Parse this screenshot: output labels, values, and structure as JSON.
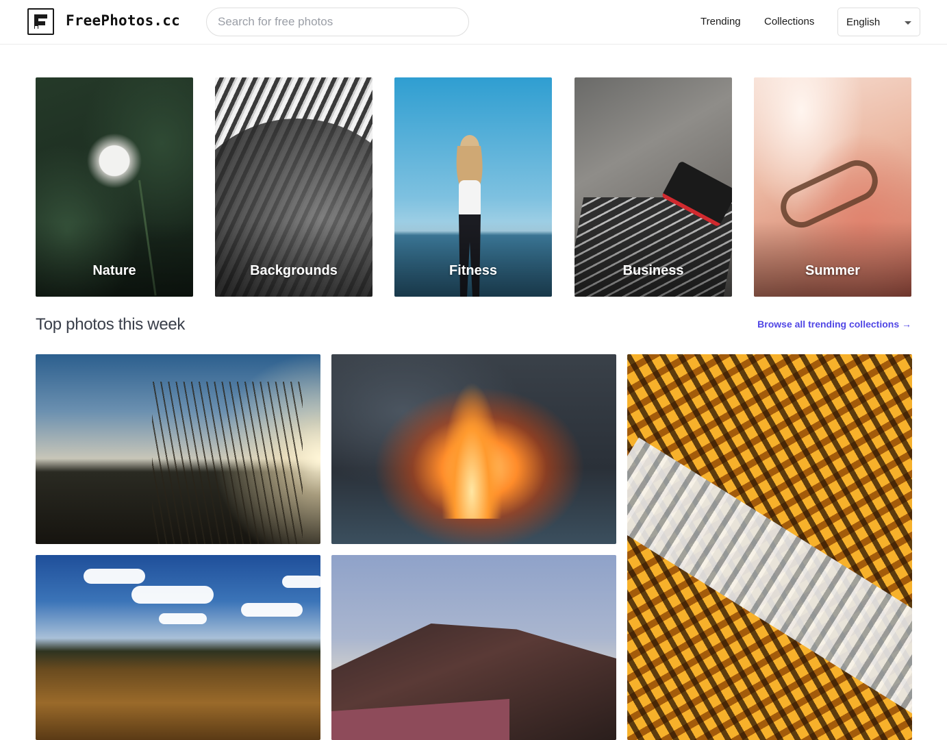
{
  "header": {
    "logo_text": "FreePhotos.cc",
    "search_placeholder": "Search for free photos",
    "nav": {
      "trending": "Trending",
      "collections": "Collections"
    },
    "language": "English"
  },
  "categories": [
    {
      "label": "Nature"
    },
    {
      "label": "Backgrounds"
    },
    {
      "label": "Fitness"
    },
    {
      "label": "Business"
    },
    {
      "label": "Summer"
    }
  ],
  "section": {
    "title": "Top photos this week",
    "browse_link": "Browse all trending collections →"
  },
  "colors": {
    "accent": "#5046e5",
    "text": "#1a202c",
    "border": "#dedede"
  }
}
